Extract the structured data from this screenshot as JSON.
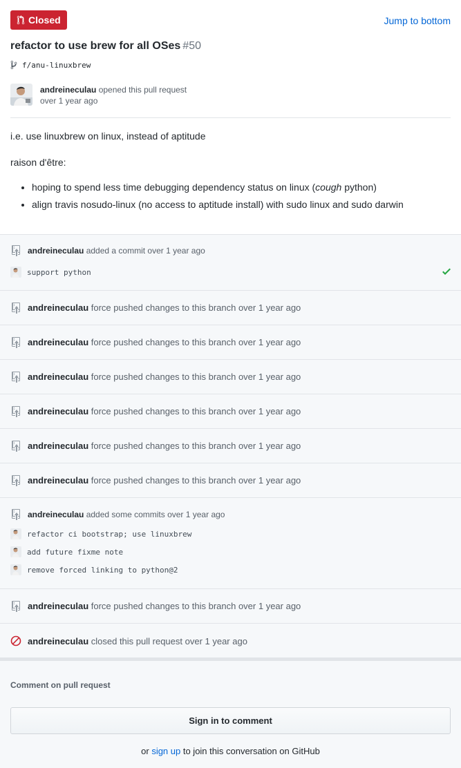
{
  "header": {
    "state_label": "Closed",
    "jump_label": "Jump to bottom"
  },
  "pr": {
    "title": "refactor to use brew for all OSes",
    "number": "#50",
    "branch": "f/anu-linuxbrew",
    "author": "andreineculau",
    "opened_text": "opened this pull request",
    "opened_time": "over 1 year ago"
  },
  "body": {
    "line1": "i.e. use linuxbrew on linux, instead of aptitude",
    "line2": "raison d'être:",
    "bullet1_pre": "hoping to spend less time debugging dependency status on linux (",
    "bullet1_em": "cough",
    "bullet1_post": " python)",
    "bullet2": "align travis nosudo-linux (no access to aptitude install) with sudo linux and sudo darwin"
  },
  "timeline": {
    "event1": {
      "author": "andreineculau",
      "text": " added a commit over 1 year ago",
      "commit": "support python"
    },
    "force_push_author": "andreineculau",
    "force_push_text": " force pushed changes to this branch over 1 year ago",
    "event_commits": {
      "author": "andreineculau",
      "text": " added some commits over 1 year ago",
      "commits": [
        "refactor ci bootstrap; use linuxbrew",
        "add future fixme note",
        "remove forced linking to python@2"
      ]
    },
    "closed": {
      "author": "andreineculau",
      "text": " closed this pull request over 1 year ago"
    }
  },
  "comment": {
    "label": "Comment on pull request",
    "signin_button": "Sign in to comment",
    "or_text": "or ",
    "signup_link": "sign up",
    "suffix_text": " to join this conversation on GitHub"
  },
  "colors": {
    "closed": "#cb2431",
    "link": "#0366d6",
    "success": "#28a745"
  },
  "icons": {
    "state": "pull-request-icon",
    "branch": "git-branch-icon",
    "push": "repo-push-icon",
    "closed": "circle-slash-icon",
    "status": "check-icon"
  }
}
